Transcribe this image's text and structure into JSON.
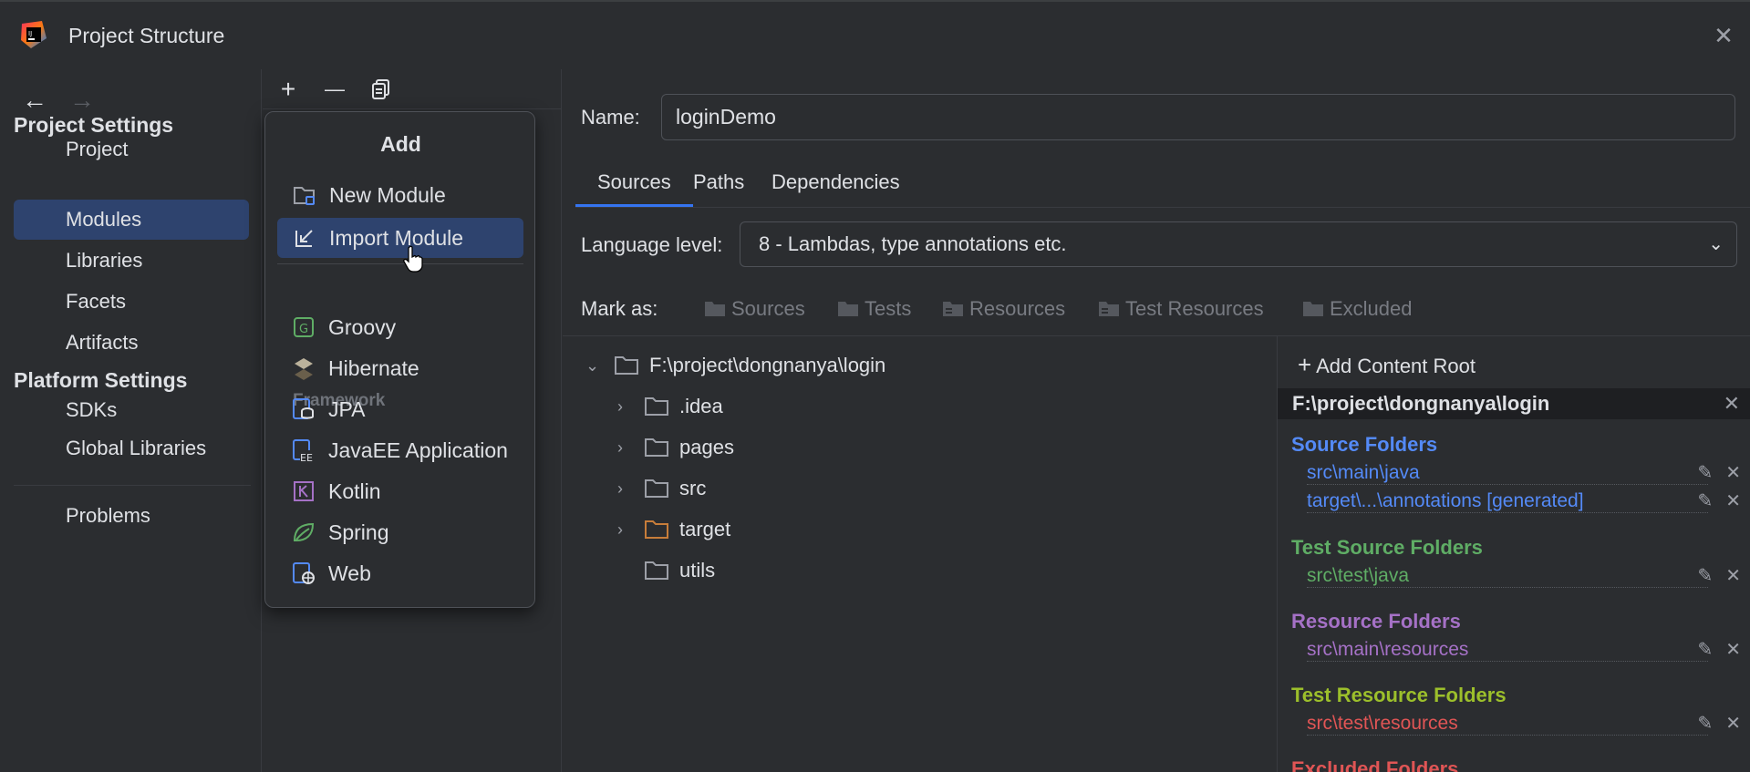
{
  "window": {
    "title": "Project Structure",
    "close": "✕"
  },
  "nav": {
    "back": "←",
    "forward": "→"
  },
  "sidebar": {
    "project_settings": "Project Settings",
    "platform_settings": "Platform Settings",
    "items_project": [
      {
        "label": "Project"
      },
      {
        "label": "Modules"
      },
      {
        "label": "Libraries"
      },
      {
        "label": "Facets"
      },
      {
        "label": "Artifacts"
      }
    ],
    "items_platform": [
      {
        "label": "SDKs"
      },
      {
        "label": "Global Libraries"
      }
    ],
    "problems": "Problems",
    "selected": "Modules"
  },
  "toolbar": {
    "add": "+",
    "remove": "—",
    "copy": "copy-icon"
  },
  "popup": {
    "title": "Add",
    "items": [
      {
        "label": "New Module",
        "icon": "new-module-icon"
      },
      {
        "label": "Import Module",
        "icon": "import-module-icon"
      }
    ],
    "framework_label": "Framework",
    "frameworks": [
      {
        "label": "Groovy",
        "icon": "groovy-icon"
      },
      {
        "label": "Hibernate",
        "icon": "hibernate-icon"
      },
      {
        "label": "JPA",
        "icon": "jpa-icon"
      },
      {
        "label": "JavaEE Application",
        "icon": "javaee-icon"
      },
      {
        "label": "Kotlin",
        "icon": "kotlin-icon"
      },
      {
        "label": "Spring",
        "icon": "spring-icon"
      },
      {
        "label": "Web",
        "icon": "web-icon"
      }
    ],
    "selected": "Import Module"
  },
  "module": {
    "name_label": "Name:",
    "name_value": "loginDemo",
    "tabs": [
      {
        "label": "Sources"
      },
      {
        "label": "Paths"
      },
      {
        "label": "Dependencies"
      }
    ],
    "active_tab": "Sources",
    "language_level_label": "Language level:",
    "language_level": "8 - Lambdas, type annotations etc.",
    "mark_as_label": "Mark as:",
    "mark_as": [
      {
        "label": "Sources"
      },
      {
        "label": "Tests"
      },
      {
        "label": "Resources"
      },
      {
        "label": "Test Resources"
      },
      {
        "label": "Excluded"
      }
    ]
  },
  "tree": {
    "root": "F:\\project\\dongnanya\\login",
    "children": [
      {
        "label": ".idea",
        "expandable": true,
        "color": "#9da0a8"
      },
      {
        "label": "pages",
        "expandable": true,
        "color": "#9da0a8"
      },
      {
        "label": "src",
        "expandable": true,
        "color": "#9da0a8"
      },
      {
        "label": "target",
        "expandable": true,
        "color": "#c77d3a"
      },
      {
        "label": "utils",
        "expandable": false,
        "color": "#9da0a8"
      }
    ]
  },
  "content_roots": {
    "add_label": "Add Content Root",
    "root": "F:\\project\\dongnanya\\login",
    "groups": [
      {
        "title": "Source Folders",
        "color": "#548af7",
        "paths": [
          "src\\main\\java",
          "target\\...\\annotations [generated]"
        ]
      },
      {
        "title": "Test Source Folders",
        "color": "#5fad65",
        "paths": [
          "src\\test\\java"
        ]
      },
      {
        "title": "Resource Folders",
        "color": "#a571c6",
        "paths": [
          "src\\main\\resources"
        ]
      },
      {
        "title": "Test Resource Folders",
        "color": "#9cbf2b",
        "path_color": "#e05555",
        "paths": [
          "src\\test\\resources"
        ]
      },
      {
        "title": "Excluded Folders",
        "color": "#e05555",
        "paths": []
      }
    ]
  }
}
